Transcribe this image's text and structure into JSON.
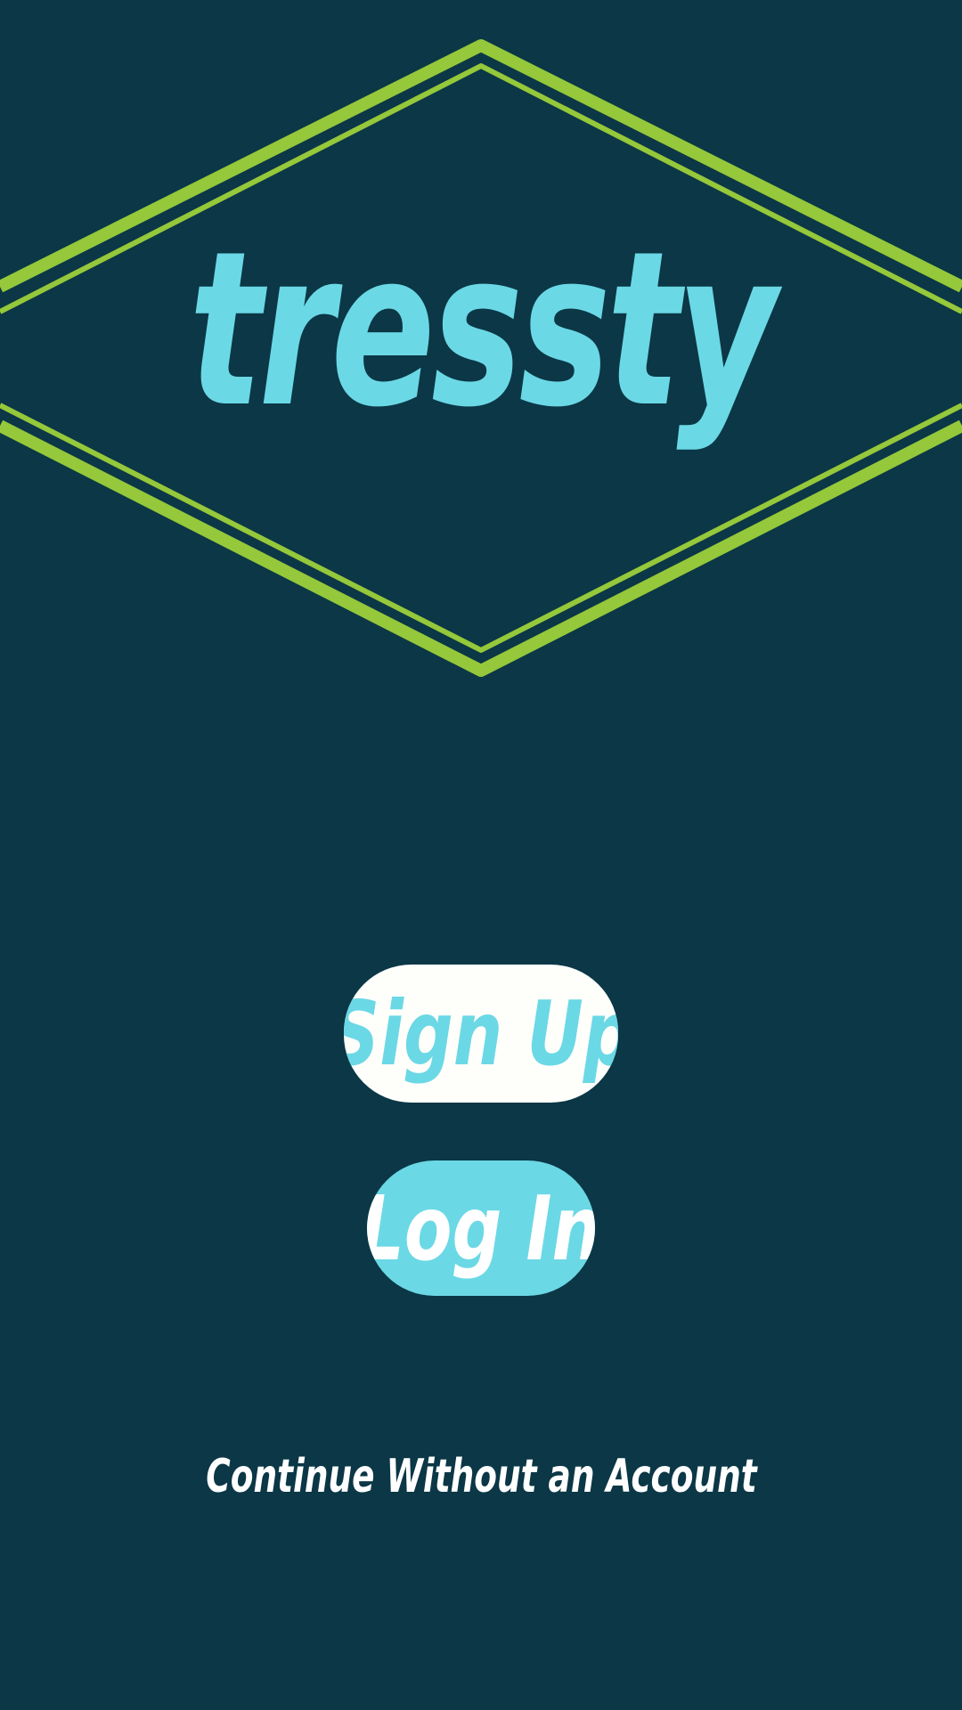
{
  "brand": {
    "name": "tressty",
    "logo_color": "#6bd8e5",
    "frame_color": "#95c83a"
  },
  "theme": {
    "background": "#0b3746",
    "button_primary_bg": "#fefefb",
    "button_secondary_bg": "#6bd8e5"
  },
  "actions": {
    "sign_up_label": "Sign Up",
    "log_in_label": "Log In",
    "continue_label": "Continue Without an Account"
  }
}
